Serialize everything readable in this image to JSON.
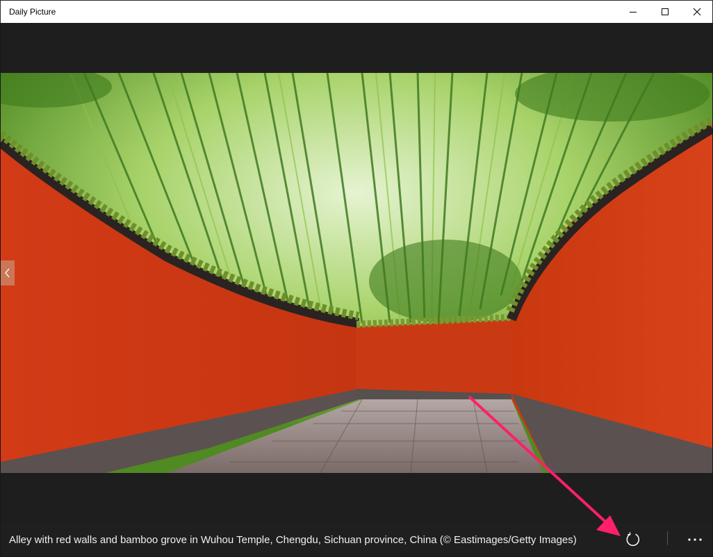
{
  "window": {
    "title": "Daily Picture",
    "minimize_icon": "minimize-icon",
    "maximize_icon": "maximize-icon",
    "close_icon": "close-icon"
  },
  "photo": {
    "subject": "Alley with red walls and bamboo grove",
    "colors": {
      "wall": "#d63d18",
      "bamboo": "#6aa82e",
      "sky": "#d9edc8",
      "path": "#8d7d7a"
    }
  },
  "navigation": {
    "previous_icon": "chevron-left-icon"
  },
  "caption": "Alley with red walls and bamboo grove in Wuhou Temple, Chengdu, Sichuan province, China (© Eastimages/Getty Images)",
  "toolbar": {
    "refresh_icon": "refresh-icon",
    "more_icon": "more-icon"
  },
  "annotation": {
    "arrow_color": "#ff1f6a"
  }
}
